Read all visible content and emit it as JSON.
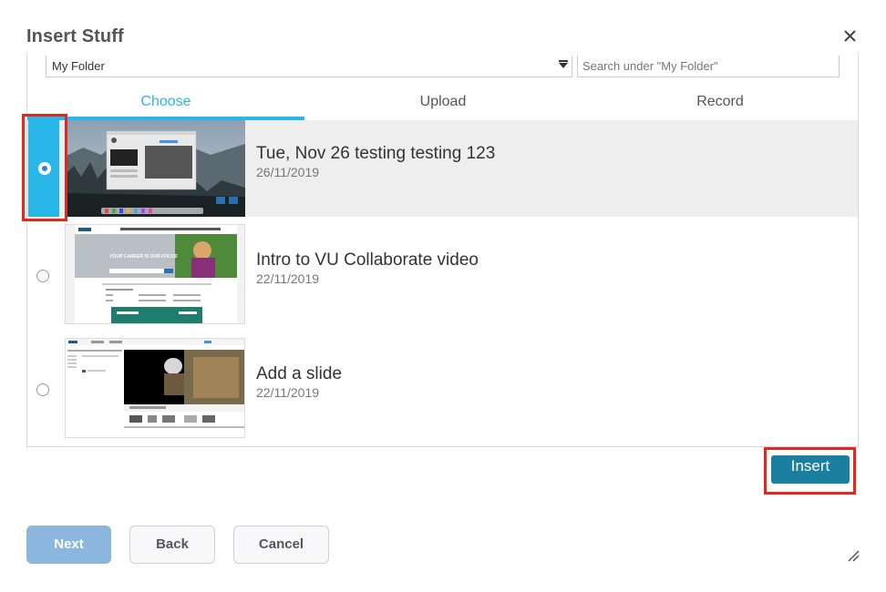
{
  "dialog": {
    "title": "Insert Stuff"
  },
  "folder": {
    "selected": "My Folder"
  },
  "search": {
    "placeholder": "Search under \"My Folder\""
  },
  "tabs": [
    {
      "label": "Choose",
      "active": true
    },
    {
      "label": "Upload",
      "active": false
    },
    {
      "label": "Record",
      "active": false
    }
  ],
  "items": [
    {
      "title": "Tue, Nov 26 testing testing 123",
      "date": "26/11/2019",
      "selected": true
    },
    {
      "title": "Intro to VU Collaborate video",
      "date": "22/11/2019",
      "selected": false
    },
    {
      "title": "Add a slide",
      "date": "22/11/2019",
      "selected": false
    }
  ],
  "thumb2": {
    "banner": "YOUR CAREER IS OUR FOCUS"
  },
  "actions": {
    "insert_label": "Insert"
  },
  "footer": {
    "next_label": "Next",
    "back_label": "Back",
    "cancel_label": "Cancel"
  },
  "colors": {
    "accent": "#29b6e8",
    "insert_button": "#1a7fa0",
    "next_button": "#8bb6dd",
    "highlight": "#e0281e"
  },
  "icons": {
    "close": "close-icon",
    "dropdown": "dropdown-caret-icon",
    "resize": "resize-handle-icon"
  }
}
